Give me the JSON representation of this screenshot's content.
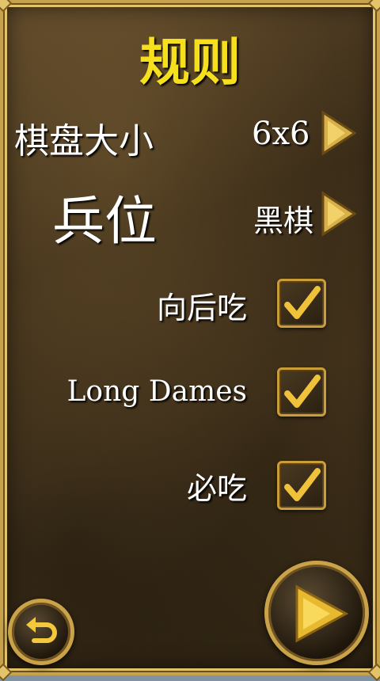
{
  "title": "规则",
  "board_size": {
    "label": "棋盘大小",
    "value": "6x6"
  },
  "pawn_position": {
    "label": "兵位",
    "value": "黑棋"
  },
  "options": [
    {
      "label": "向后吃",
      "checked": true
    },
    {
      "label": "Long Dames",
      "checked": true
    },
    {
      "label": "必吃",
      "checked": true
    }
  ],
  "colors": {
    "title": "#f6df1c",
    "gold": "#c99d3a"
  },
  "icons": {
    "next": "play-arrow-icon",
    "back": "undo-arrow-icon",
    "check": "checkmark-icon"
  }
}
